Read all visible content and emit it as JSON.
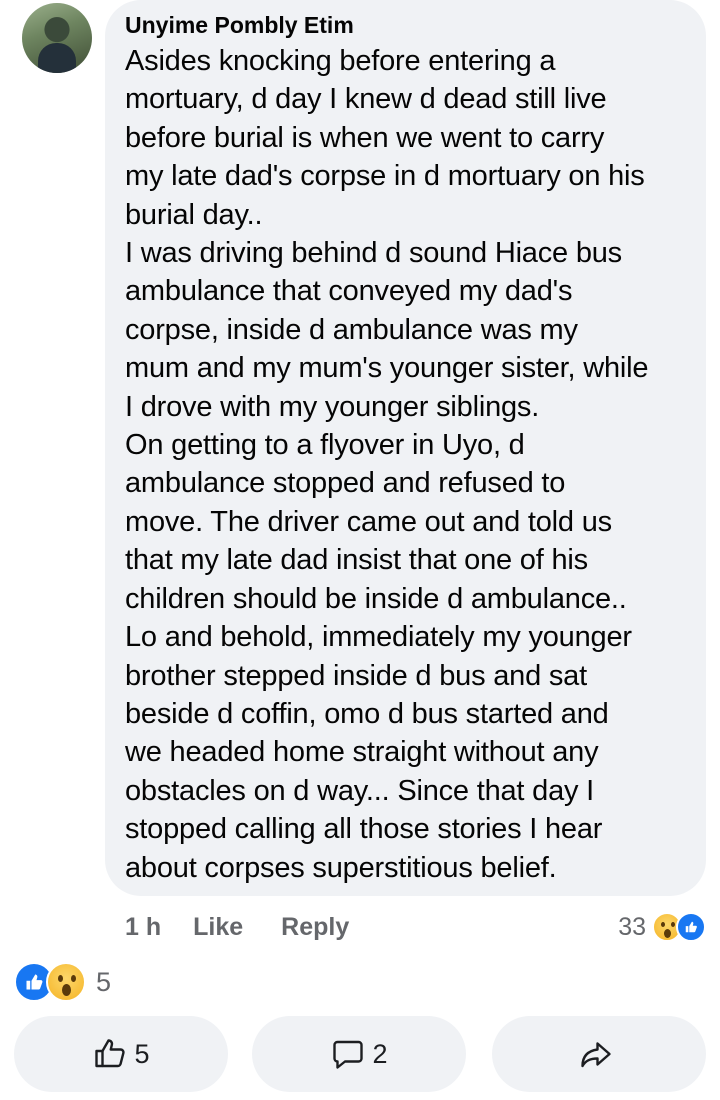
{
  "comment": {
    "author": "Unyime Pombly Etim",
    "text": "Asides knocking before entering a\nmortuary, d day I knew d dead still live\nbefore burial is when we went to carry\nmy late dad's corpse in d mortuary on his\nburial day..\nI was driving behind d sound Hiace bus\nambulance that conveyed my dad's\ncorpse, inside d ambulance was my\nmum and my mum's younger sister, while\nI drove with my younger siblings.\nOn getting to a flyover in Uyo, d\nambulance stopped and refused to\nmove. The driver came out and told us\nthat my late dad insist that one of his\nchildren should be inside d ambulance..\nLo and behold, immediately my younger\nbrother stepped inside d bus and sat\nbeside d coffin, omo d bus started and\nwe headed home straight without any\nobstacles on d way... Since that day I\nstopped calling all those stories I hear\nabout corpses superstitious belief.",
    "time": "1 h",
    "like_label": "Like",
    "reply_label": "Reply",
    "reaction_count": "33",
    "reaction_icons": [
      "wow-emoji-icon",
      "like-emoji-icon"
    ]
  },
  "post": {
    "reaction_count": "5",
    "reaction_icons": [
      "like-emoji-icon",
      "wow-emoji-icon"
    ],
    "like_count": "5",
    "comment_count": "2"
  },
  "colors": {
    "bubble": "#f0f2f5",
    "secondary_text": "#65676b",
    "like_blue": "#1877f2"
  }
}
